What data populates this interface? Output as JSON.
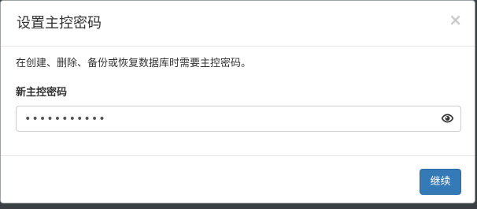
{
  "dialog": {
    "title": "设置主控密码",
    "close_symbol": "×",
    "description": "在创建、删除、备份或恢复数据库时需要主控密码。",
    "field_label": "新主控密码",
    "password_value": "•••••••••••",
    "show_password_icon": "eye-icon",
    "continue_label": "继续"
  },
  "colors": {
    "primary": "#337ab7",
    "backdrop": "#3a3f44"
  }
}
